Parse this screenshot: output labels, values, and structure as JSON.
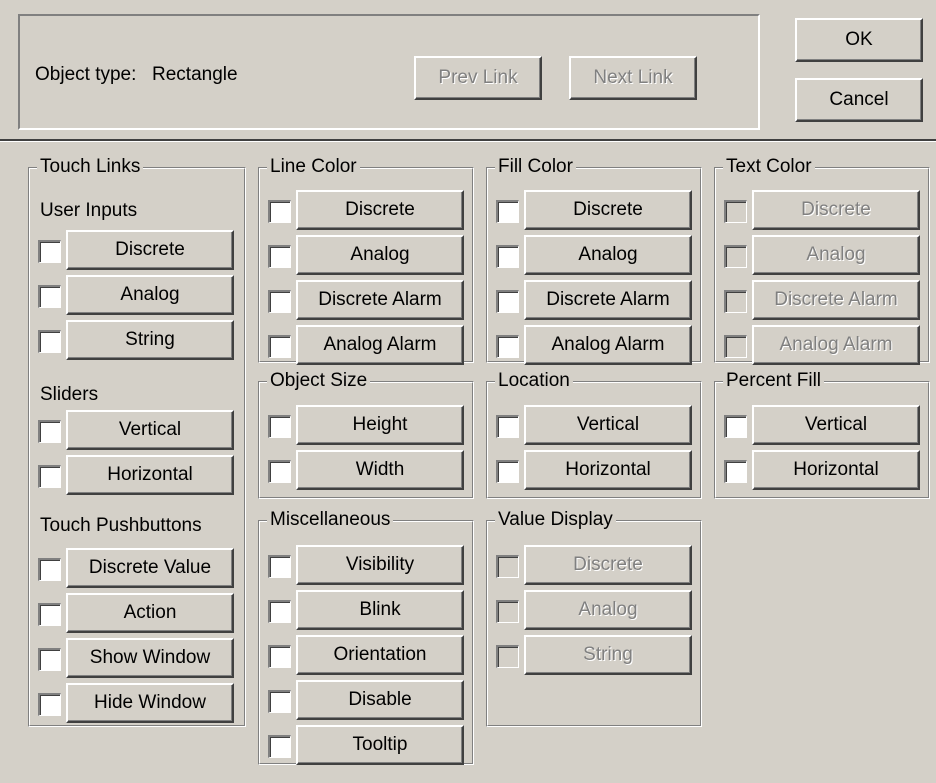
{
  "header": {
    "object_type_label": "Object type:",
    "object_type_value": "Rectangle",
    "prev_link": "Prev Link",
    "next_link": "Next Link",
    "ok": "OK",
    "cancel": "Cancel"
  },
  "touch_links": {
    "title": "Touch Links",
    "user_inputs_label": "User Inputs",
    "user_inputs": [
      "Discrete",
      "Analog",
      "String"
    ],
    "sliders_label": "Sliders",
    "sliders": [
      "Vertical",
      "Horizontal"
    ],
    "pushbuttons_label": "Touch Pushbuttons",
    "pushbuttons": [
      "Discrete Value",
      "Action",
      "Show Window",
      "Hide Window"
    ]
  },
  "line_color": {
    "title": "Line Color",
    "items": [
      "Discrete",
      "Analog",
      "Discrete Alarm",
      "Analog Alarm"
    ]
  },
  "fill_color": {
    "title": "Fill Color",
    "items": [
      "Discrete",
      "Analog",
      "Discrete Alarm",
      "Analog Alarm"
    ]
  },
  "text_color": {
    "title": "Text Color",
    "items": [
      "Discrete",
      "Analog",
      "Discrete Alarm",
      "Analog Alarm"
    ],
    "enabled": false
  },
  "object_size": {
    "title": "Object Size",
    "items": [
      "Height",
      "Width"
    ]
  },
  "location": {
    "title": "Location",
    "items": [
      "Vertical",
      "Horizontal"
    ]
  },
  "percent_fill": {
    "title": "Percent Fill",
    "items": [
      "Vertical",
      "Horizontal"
    ]
  },
  "miscellaneous": {
    "title": "Miscellaneous",
    "items": [
      "Visibility",
      "Blink",
      "Orientation",
      "Disable",
      "Tooltip"
    ]
  },
  "value_display": {
    "title": "Value Display",
    "items": [
      "Discrete",
      "Analog",
      "String"
    ],
    "enabled": false
  },
  "colors": {
    "face": "#d4d0c8",
    "disabled_text": "#808080"
  }
}
